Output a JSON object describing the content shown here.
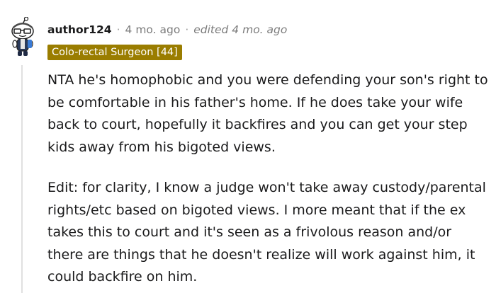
{
  "comment": {
    "author": "author124",
    "separator": "·",
    "timestamp": "4 mo. ago",
    "edited": "edited 4 mo. ago",
    "flair": "Colo-rectal Surgeon [44]",
    "flair_color": "#9a7d00",
    "avatar_icon": "snoo-avatar-icon",
    "paragraphs": [
      "NTA he's homophobic and you were defending your son's right to be comfortable in his father's home. If he does take your wife back to court, hopefully it backfires and you can get your step kids away from his bigoted views.",
      "Edit: for clarity, I know a judge won't take away custody/parental rights/etc based on bigoted views. I more meant that if the ex takes this to court and it's seen as a frivolous reason and/or there are things that he doesn't realize will work against him, it could backfire on him."
    ]
  }
}
